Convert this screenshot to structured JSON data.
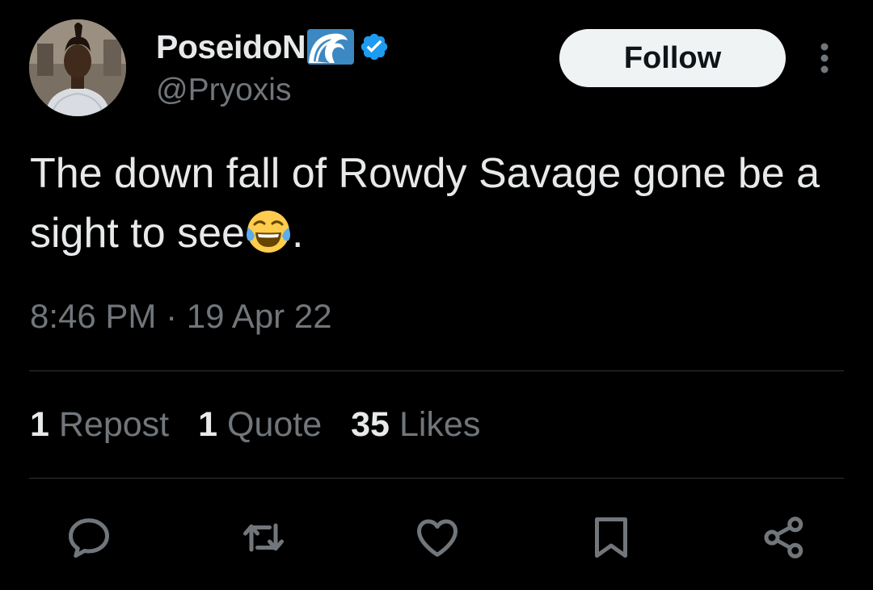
{
  "author": {
    "display_name": "PoseidoN",
    "handle": "@Pryoxis",
    "verified": true,
    "avatar_icon": "profile-photo"
  },
  "follow_label": "Follow",
  "tweet": {
    "text_before_emoji": "The down fall of Rowdy Savage gone be a sight to see",
    "text_after_emoji": ".",
    "timestamp": "8:46 PM · 19 Apr 22"
  },
  "stats": {
    "reposts_count": "1",
    "reposts_label": "Repost",
    "quotes_count": "1",
    "quotes_label": "Quote",
    "likes_count": "35",
    "likes_label": "Likes"
  },
  "actions": [
    "reply-icon",
    "repost-icon",
    "like-icon",
    "bookmark-icon",
    "share-icon"
  ],
  "colors": {
    "background": "#000000",
    "text_primary": "#e7e9ea",
    "text_secondary": "#71767b",
    "verified_blue": "#1d9bf0",
    "divider": "#2f3336",
    "follow_button_bg": "#eff3f4"
  }
}
